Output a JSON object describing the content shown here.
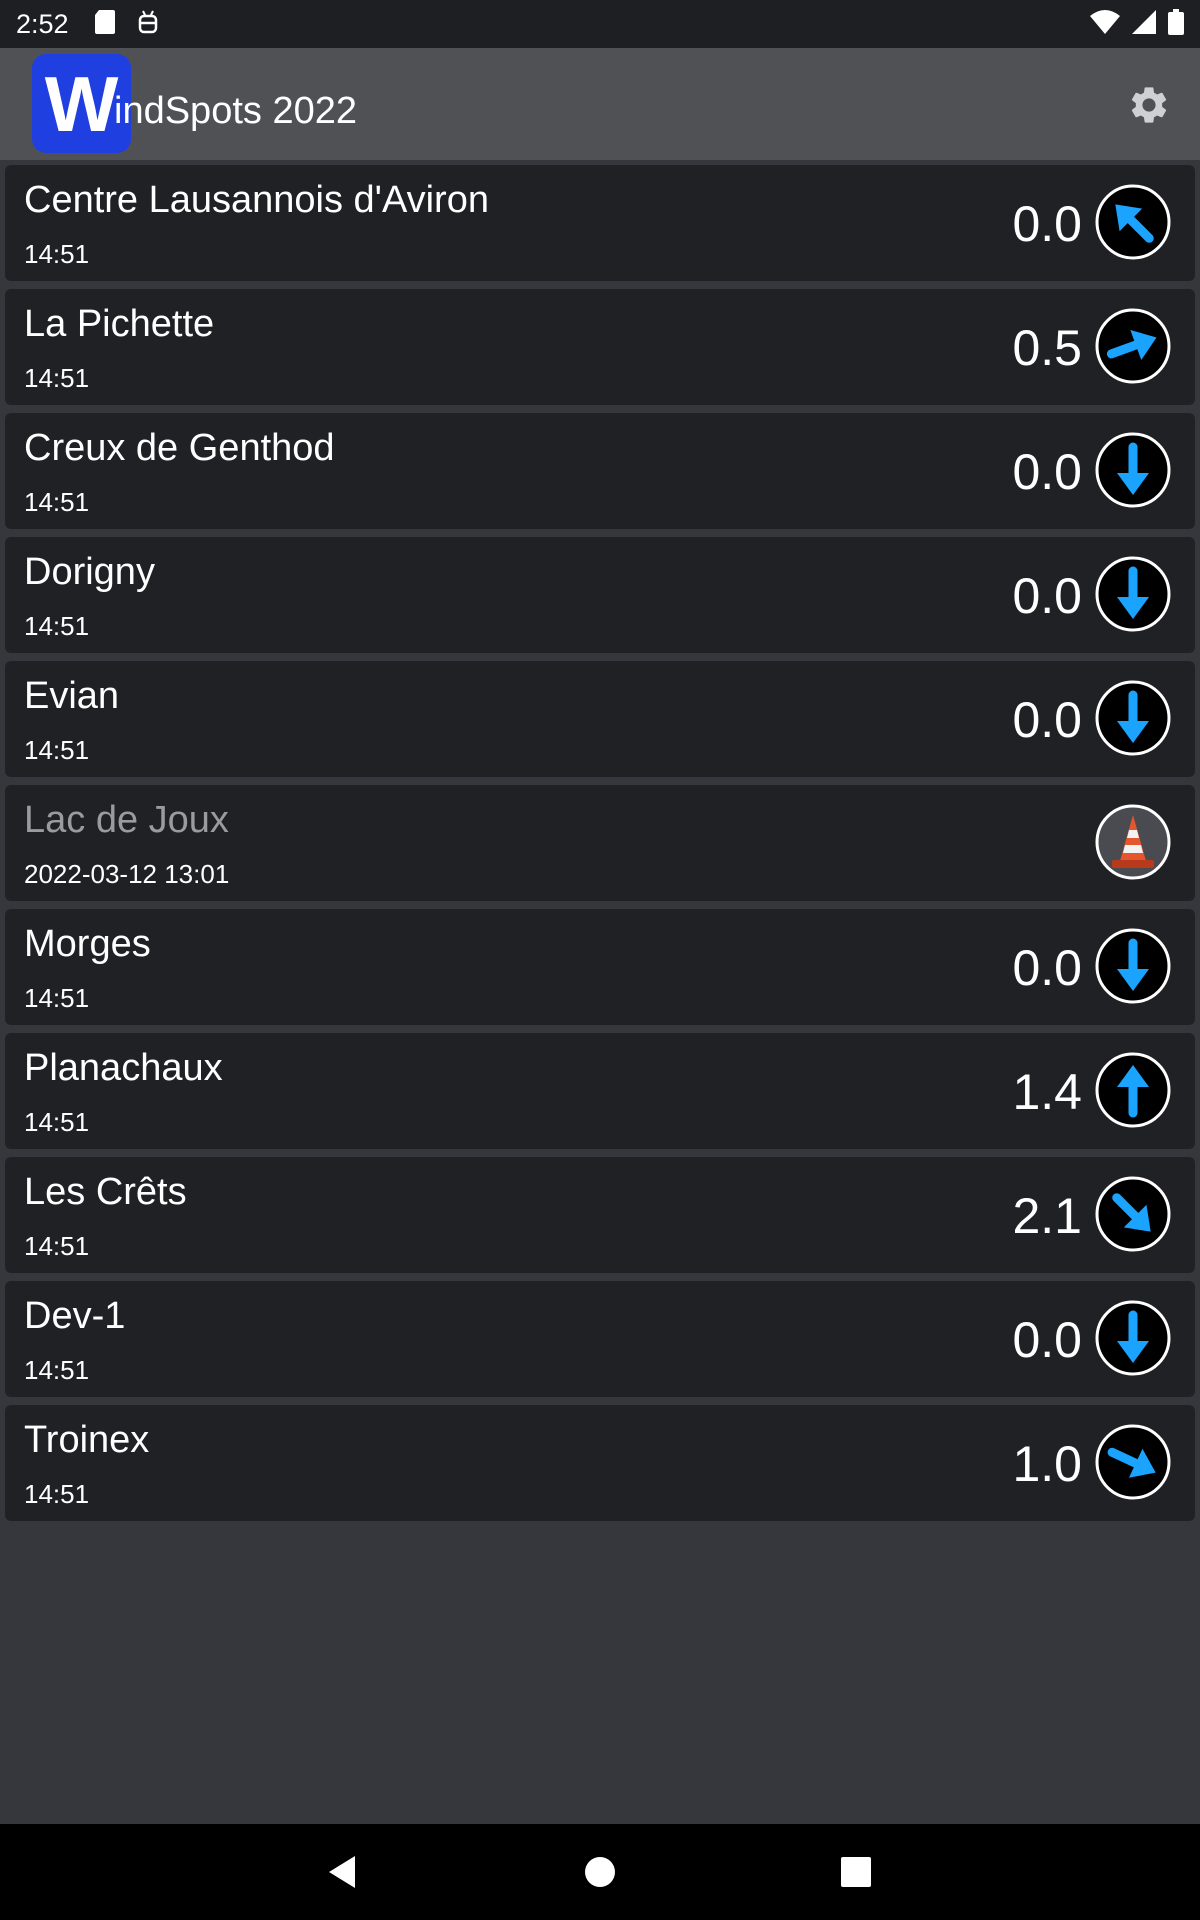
{
  "status_bar": {
    "time": "2:52",
    "icons_left": [
      "sd-card-icon",
      "android-debug-icon"
    ],
    "icons_right": [
      "wifi-icon",
      "cell-signal-icon",
      "battery-icon"
    ]
  },
  "app_bar": {
    "logo_letter": "W",
    "title": "WindSpots 2022",
    "settings_icon": "gear-icon"
  },
  "colors": {
    "arrow": "#1aa3ff",
    "logo": "#1f3fe0",
    "row_bg": "#202125",
    "page_bg": "#36373c"
  },
  "spots": [
    {
      "name": "Centre Lausannois d'Aviron",
      "time": "14:51",
      "speed": "0.0",
      "direction_deg": 315,
      "status": "active"
    },
    {
      "name": "La Pichette",
      "time": "14:51",
      "speed": "0.5",
      "direction_deg": 70,
      "status": "active"
    },
    {
      "name": "Creux de Genthod",
      "time": "14:51",
      "speed": "0.0",
      "direction_deg": 180,
      "status": "active"
    },
    {
      "name": "Dorigny",
      "time": "14:51",
      "speed": "0.0",
      "direction_deg": 180,
      "status": "active"
    },
    {
      "name": "Evian",
      "time": "14:51",
      "speed": "0.0",
      "direction_deg": 180,
      "status": "active"
    },
    {
      "name": "Lac de Joux",
      "time": "2022-03-12 13:01",
      "speed": "",
      "direction_deg": null,
      "status": "offline"
    },
    {
      "name": "Morges",
      "time": "14:51",
      "speed": "0.0",
      "direction_deg": 180,
      "status": "active"
    },
    {
      "name": "Planachaux",
      "time": "14:51",
      "speed": "1.4",
      "direction_deg": 0,
      "status": "active"
    },
    {
      "name": "Les Crêts",
      "time": "14:51",
      "speed": "2.1",
      "direction_deg": 135,
      "status": "active"
    },
    {
      "name": "Dev-1",
      "time": "14:51",
      "speed": "0.0",
      "direction_deg": 180,
      "status": "active"
    },
    {
      "name": "Troinex",
      "time": "14:51",
      "speed": "1.0",
      "direction_deg": 115,
      "status": "active"
    }
  ],
  "nav_bar": {
    "back_icon": "back-triangle-icon",
    "home_icon": "home-circle-icon",
    "recents_icon": "recents-square-icon"
  }
}
